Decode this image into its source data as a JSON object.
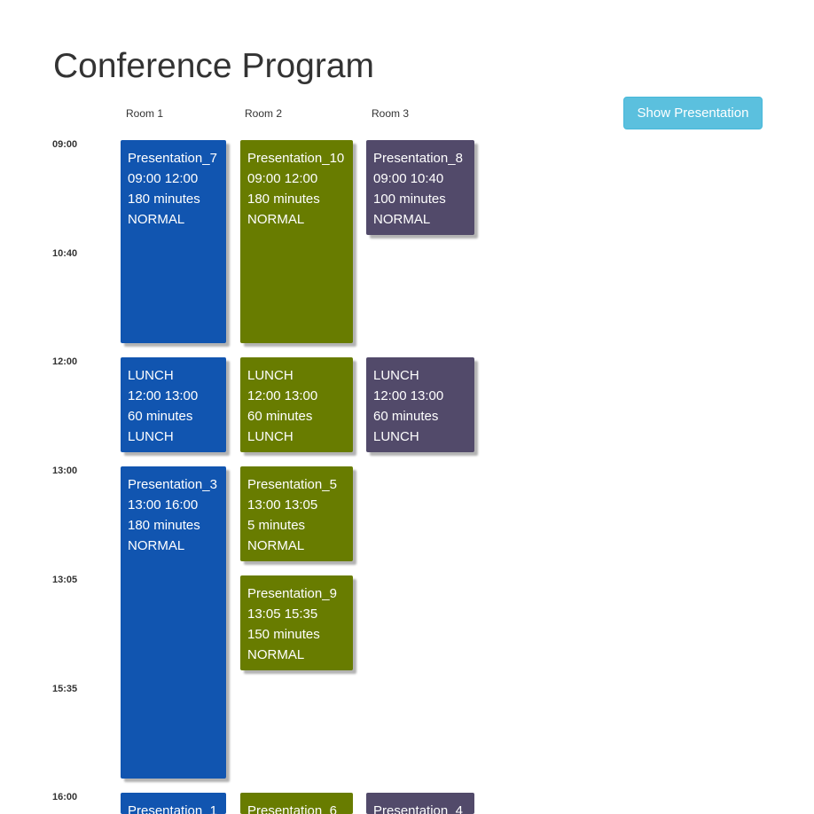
{
  "page": {
    "title": "Conference Program",
    "show_button_label": "Show Presentation"
  },
  "rooms": [
    "Room 1",
    "Room 2",
    "Room 3"
  ],
  "time_labels": [
    "09:00",
    "10:40",
    "12:00",
    "13:00",
    "13:05",
    "15:35",
    "16:00"
  ],
  "colors": {
    "room1": "#1155b0",
    "room2": "#687c00",
    "room3": "#524a6a",
    "button": "#5bc0de"
  },
  "sessions": {
    "r1_pres7": {
      "name": "Presentation_7",
      "time": "09:00 12:00",
      "duration": "180 minutes",
      "type": "NORMAL"
    },
    "r2_pres10": {
      "name": "Presentation_10",
      "time": "09:00 12:00",
      "duration": "180 minutes",
      "type": "NORMAL"
    },
    "r3_pres8": {
      "name": "Presentation_8",
      "time": "09:00 10:40",
      "duration": "100 minutes",
      "type": "NORMAL"
    },
    "r1_lunch": {
      "name": "LUNCH",
      "time": "12:00 13:00",
      "duration": "60 minutes",
      "type": "LUNCH"
    },
    "r2_lunch": {
      "name": "LUNCH",
      "time": "12:00 13:00",
      "duration": "60 minutes",
      "type": "LUNCH"
    },
    "r3_lunch": {
      "name": "LUNCH",
      "time": "12:00 13:00",
      "duration": "60 minutes",
      "type": "LUNCH"
    },
    "r1_pres3": {
      "name": "Presentation_3",
      "time": "13:00 16:00",
      "duration": "180 minutes",
      "type": "NORMAL"
    },
    "r2_pres5": {
      "name": "Presentation_5",
      "time": "13:00 13:05",
      "duration": "5 minutes",
      "type": "NORMAL"
    },
    "r2_pres9": {
      "name": "Presentation_9",
      "time": "13:05 15:35",
      "duration": "150 minutes",
      "type": "NORMAL"
    },
    "r1_pres1": {
      "name": "Presentation_1"
    },
    "r2_pres6": {
      "name": "Presentation_6"
    },
    "r3_pres4": {
      "name": "Presentation_4"
    }
  }
}
